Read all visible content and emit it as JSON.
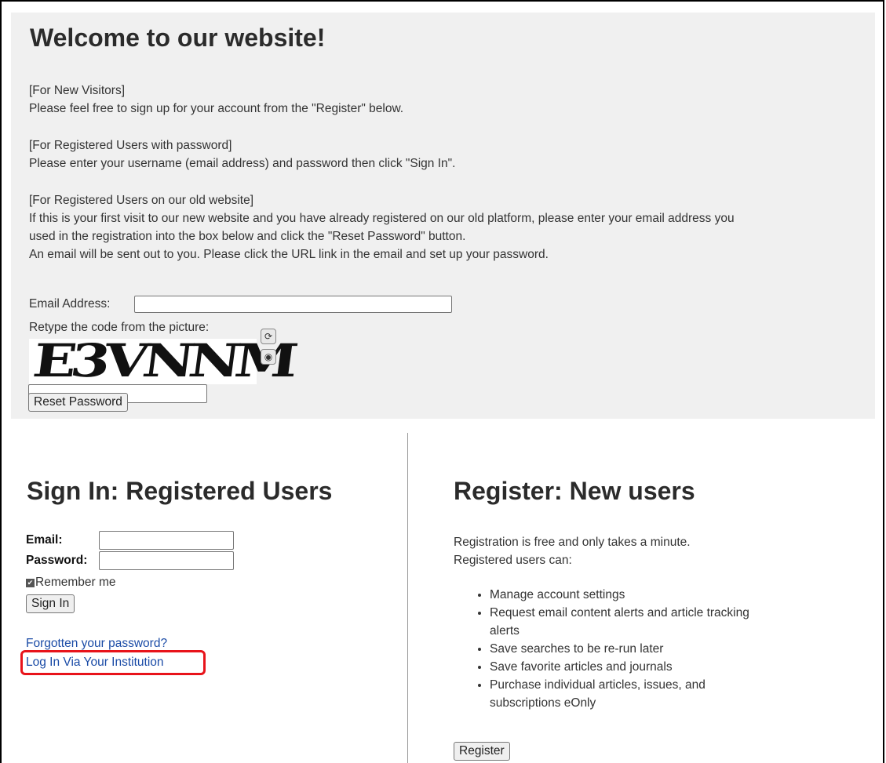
{
  "welcome": {
    "title": "Welcome to our website!",
    "new_visitors_heading": "[For New Visitors]",
    "new_visitors_text": "Please feel free to sign up for your account from the \"Register\" below.",
    "registered_heading": "[For Registered Users with password]",
    "registered_text": "Please enter your username (email address) and password then click \"Sign In\".",
    "old_site_heading": "[For Registered Users on our old website]",
    "old_site_text_1": "If this is your first visit to our new website and you have already registered on our old platform, please enter your email address you",
    "old_site_text_2": "used in the registration into the box below and click the \"Reset Password\" button.",
    "old_site_text_3": "An email will be sent out to you. Please click the URL link in the email and set up your password.",
    "email_label": "Email Address:",
    "email_value": "",
    "retype_label": "Retype the code from the picture:",
    "captcha_text": "E3VNNM",
    "code_value": "",
    "reset_button": "Reset Password"
  },
  "signin": {
    "title": "Sign In: Registered Users",
    "email_label": "Email:",
    "password_label": "Password:",
    "email_value": "",
    "password_value": "",
    "remember_label": "Remember me",
    "remember_checked": true,
    "signin_button": "Sign In",
    "forgot_link": "Forgotten your password?",
    "institution_link": "Log In Via Your Institution"
  },
  "register": {
    "title": "Register: New users",
    "intro_1": "Registration is free and only takes a minute.",
    "intro_2": "Registered users can:",
    "benefits": [
      "Manage account settings",
      "Request email content alerts and article tracking alerts",
      "Save searches to be re-run later",
      "Save favorite articles and journals",
      "Purchase individual articles, issues, and subscriptions eOnly"
    ],
    "register_button": "Register"
  },
  "colors": {
    "panel_bg": "#f0f0f0",
    "link": "#1a4ba6",
    "highlight": "#e8131a"
  }
}
